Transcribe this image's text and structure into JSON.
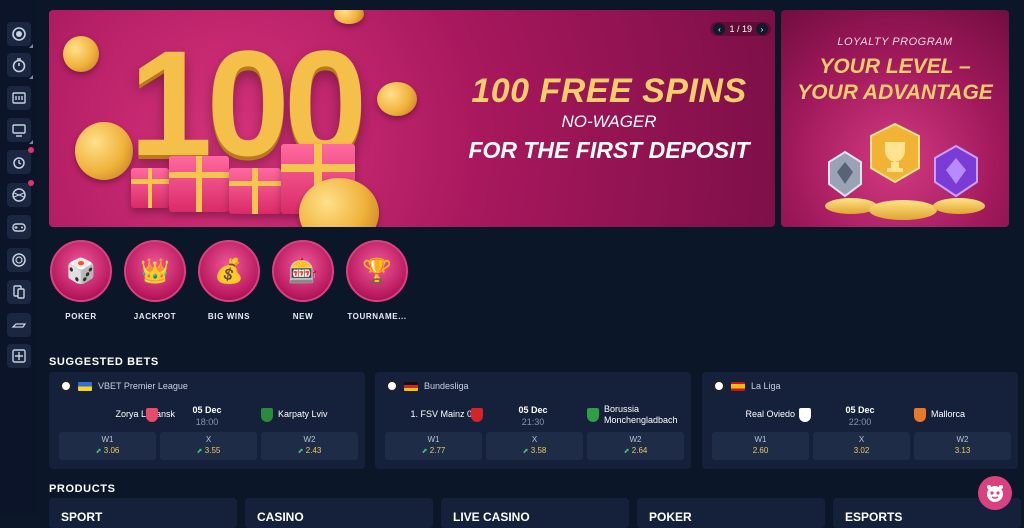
{
  "sidebar": {
    "items": [
      {
        "name": "live-icon"
      },
      {
        "name": "timer-icon"
      },
      {
        "name": "slots-icon"
      },
      {
        "name": "live-casino-icon"
      },
      {
        "name": "aviator-icon"
      },
      {
        "name": "ball-icon"
      },
      {
        "name": "games-icon"
      },
      {
        "name": "poker-chip-icon"
      },
      {
        "name": "cards-icon"
      },
      {
        "name": "racing-icon"
      },
      {
        "name": "more-icon"
      }
    ]
  },
  "banner": {
    "big_number": "100",
    "line1": "100 FREE SPINS",
    "line2": "NO-WAGER",
    "line3": "FOR THE FIRST DEPOSIT",
    "pager": "1 / 19",
    "prev": "‹",
    "next": "›"
  },
  "loyalty": {
    "title": "LOYALTY PROGRAM",
    "main_l1": "YOUR LEVEL –",
    "main_l2": "YOUR ADVANTAGE"
  },
  "categories": [
    {
      "label": "POKER",
      "icon": "🎲"
    },
    {
      "label": "JACKPOT",
      "icon": "👑"
    },
    {
      "label": "BIG WINS",
      "icon": "💰"
    },
    {
      "label": "NEW",
      "icon": "🎰"
    },
    {
      "label": "TOURNAME...",
      "icon": "🏆"
    }
  ],
  "suggested": {
    "title": "SUGGESTED BETS",
    "prev": "‹",
    "next": "›",
    "cards": [
      {
        "league": "VBET Premier League",
        "flag_colors": [
          "#2f6fd6",
          "#f7d61c"
        ],
        "home": "Zorya Luhansk",
        "away": "Karpaty Lviv",
        "date": "05 Dec",
        "time": "18:00",
        "odds": [
          {
            "k": "W1",
            "v": "3.06",
            "trend": true
          },
          {
            "k": "X",
            "v": "3.55",
            "trend": true
          },
          {
            "k": "W2",
            "v": "2.43",
            "trend": true
          }
        ]
      },
      {
        "league": "Bundesliga",
        "flag_colors": [
          "#111111",
          "#d4232b",
          "#f5c400"
        ],
        "home": "1. FSV Mainz 05",
        "away_l1": "Borussia",
        "away_l2": "Monchengladbach",
        "date": "05 Dec",
        "time": "21:30",
        "odds": [
          {
            "k": "W1",
            "v": "2.77",
            "trend": true
          },
          {
            "k": "X",
            "v": "3.58",
            "trend": true
          },
          {
            "k": "W2",
            "v": "2.64",
            "trend": true
          }
        ]
      },
      {
        "league": "La Liga",
        "flag_colors": [
          "#c8102e",
          "#f1bf00"
        ],
        "home": "Real Oviedo",
        "away": "Mallorca",
        "date": "05 Dec",
        "time": "22:00",
        "odds": [
          {
            "k": "W1",
            "v": "2.60",
            "trend": false
          },
          {
            "k": "X",
            "v": "3.02",
            "trend": false
          },
          {
            "k": "W2",
            "v": "3.13",
            "trend": false
          }
        ]
      }
    ]
  },
  "products": {
    "title": "PRODUCTS",
    "items": [
      "SPORT",
      "CASINO",
      "LIVE CASINO",
      "POKER",
      "ESPORTS"
    ]
  },
  "colors": {
    "background": "#0c1629",
    "accent": "#d9417f",
    "odds": "#f0c75a"
  }
}
